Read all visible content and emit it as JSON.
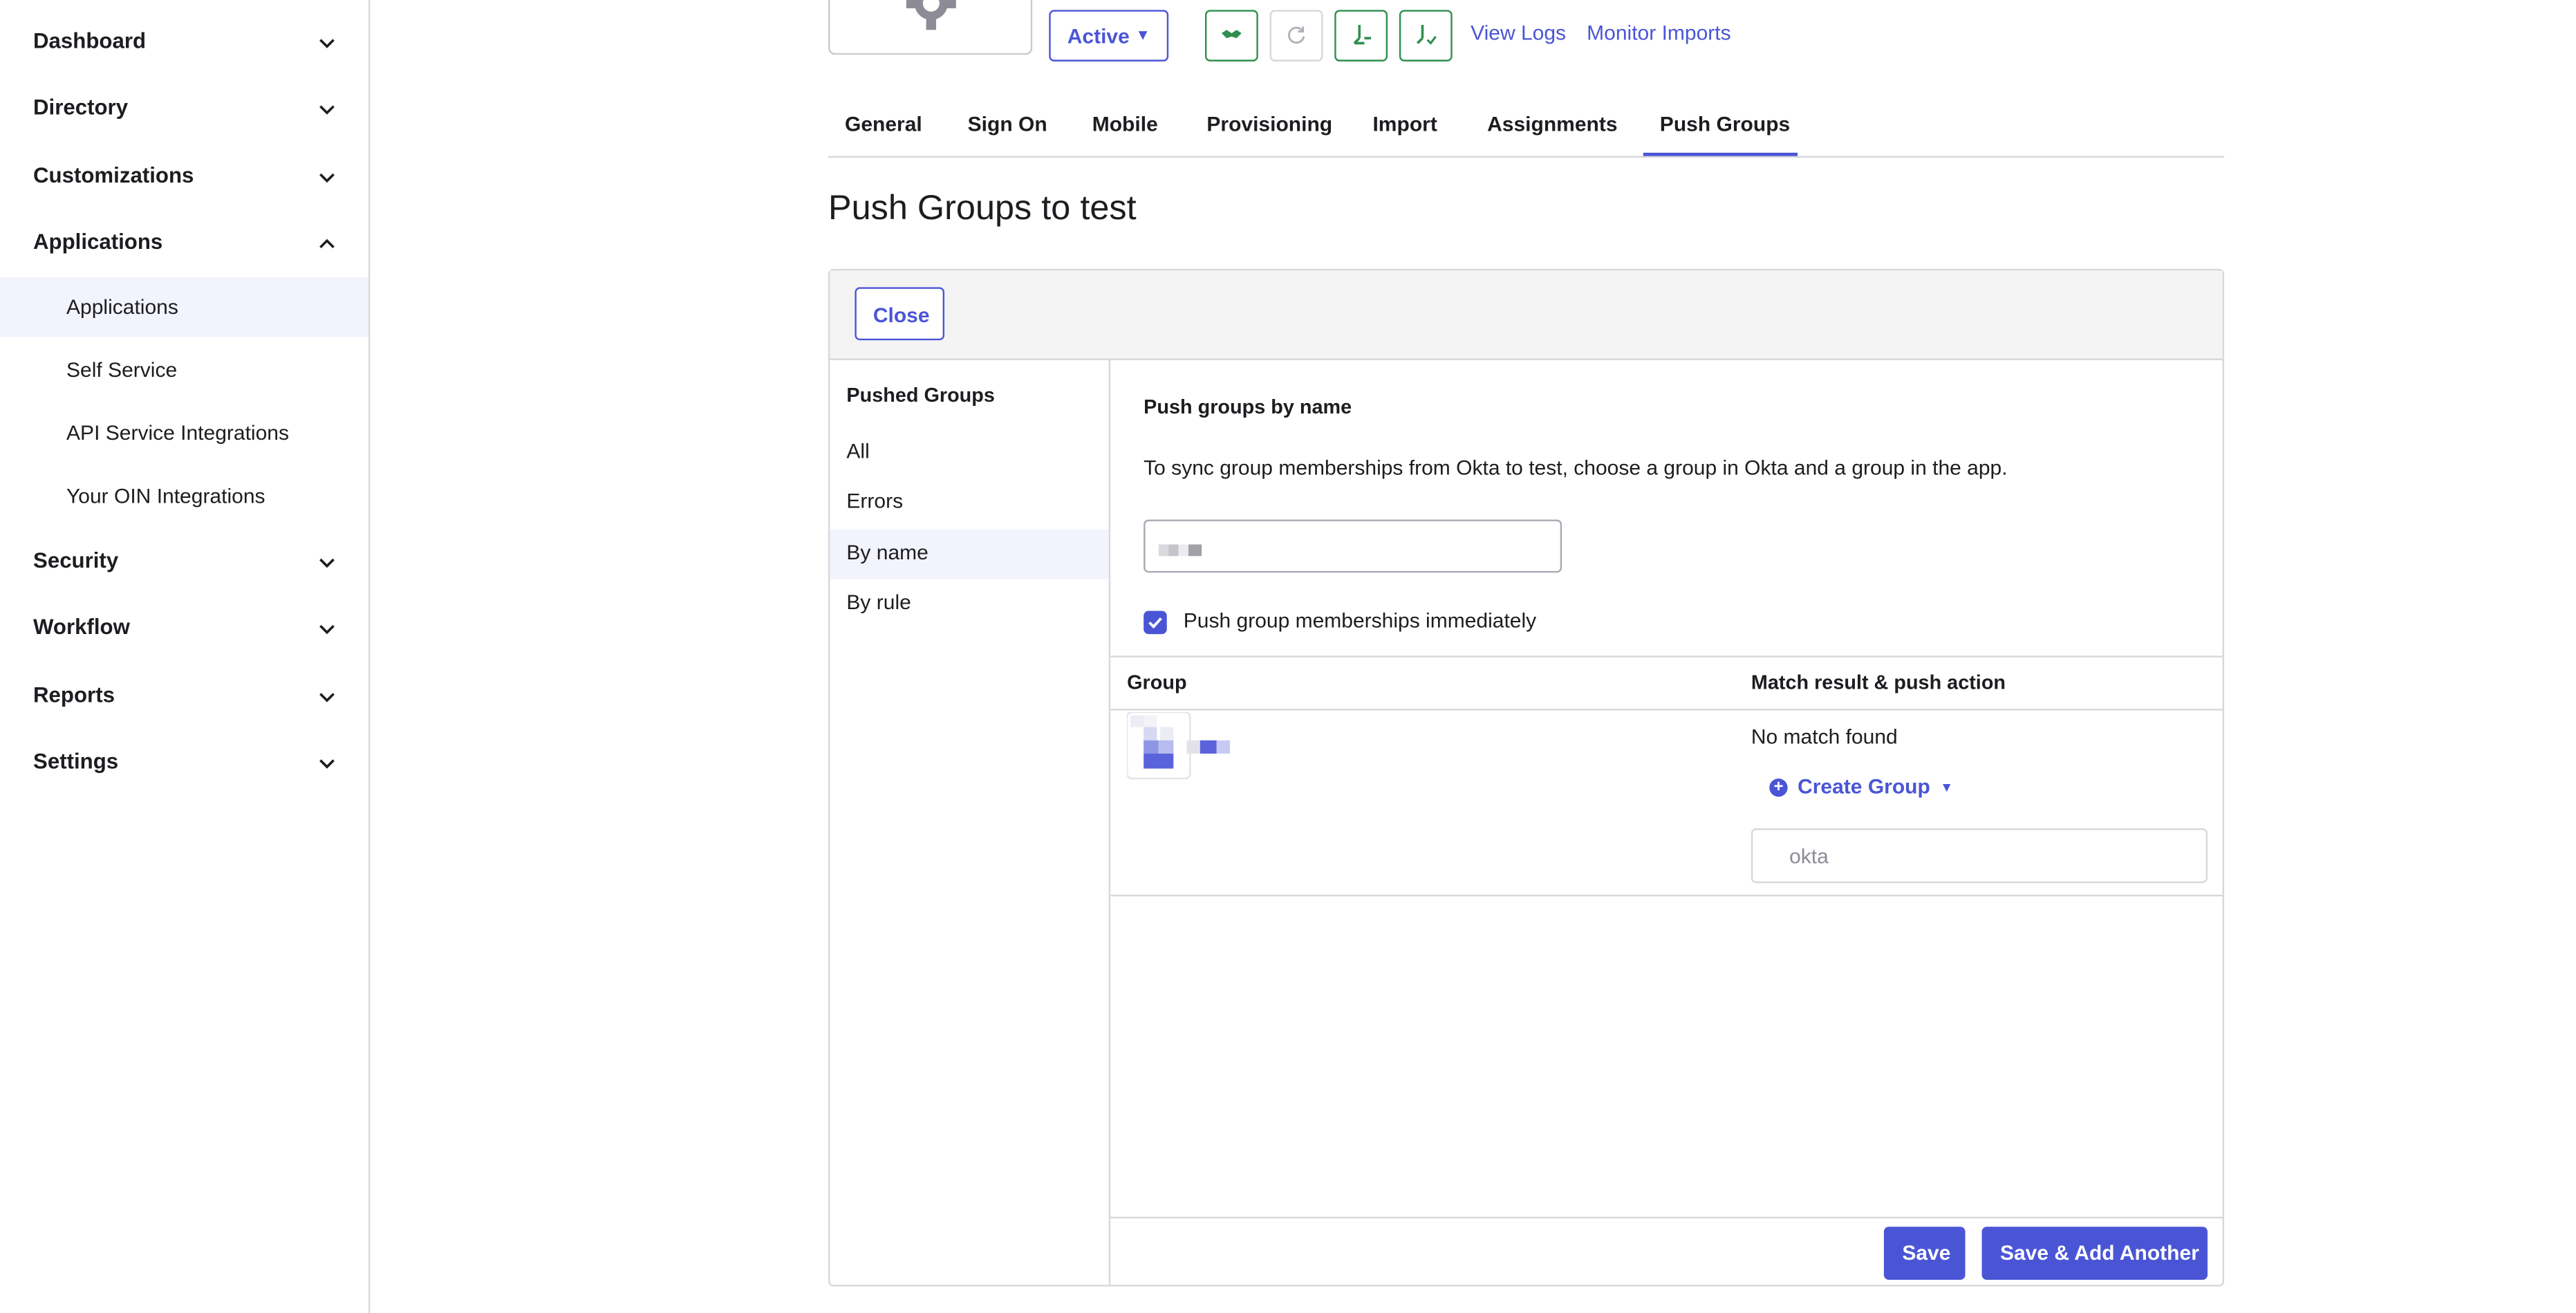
{
  "sidebar": {
    "sections": [
      {
        "label": "Dashboard",
        "expanded": false
      },
      {
        "label": "Directory",
        "expanded": false
      },
      {
        "label": "Customizations",
        "expanded": false
      },
      {
        "label": "Applications",
        "expanded": true
      },
      {
        "label": "Security",
        "expanded": false
      },
      {
        "label": "Workflow",
        "expanded": false
      },
      {
        "label": "Reports",
        "expanded": false
      },
      {
        "label": "Settings",
        "expanded": false
      }
    ],
    "applications_items": [
      {
        "label": "Applications",
        "active": true
      },
      {
        "label": "Self Service"
      },
      {
        "label": "API Service Integrations"
      },
      {
        "label": "Your OIN Integrations"
      }
    ]
  },
  "header": {
    "status_label": "Active",
    "action_icons": [
      "handshake-icon",
      "refresh-icon",
      "user-push-icon",
      "user-check-icon"
    ],
    "view_logs": "View Logs",
    "monitor_imports": "Monitor Imports"
  },
  "tabs": [
    {
      "label": "General"
    },
    {
      "label": "Sign On"
    },
    {
      "label": "Mobile"
    },
    {
      "label": "Provisioning"
    },
    {
      "label": "Import"
    },
    {
      "label": "Assignments"
    },
    {
      "label": "Push Groups",
      "active": true
    }
  ],
  "page_title": "Push Groups to test",
  "panel": {
    "close_label": "Close",
    "pushed_groups_heading": "Pushed Groups",
    "filters": [
      {
        "label": "All"
      },
      {
        "label": "Errors"
      },
      {
        "label": "By name",
        "active": true
      },
      {
        "label": "By rule"
      }
    ],
    "right": {
      "title": "Push groups by name",
      "description": "To sync group memberships from Okta to test, choose a group in Okta and a group in the app.",
      "push_immediately_label": "Push group memberships immediately",
      "push_immediately_checked": true,
      "columns": {
        "group": "Group",
        "match": "Match result & push action"
      },
      "row": {
        "match_result": "No match found",
        "create_group_label": "Create Group",
        "group_input_placeholder": "okta"
      },
      "save_label": "Save",
      "save_add_label": "Save & Add Another"
    }
  },
  "colors": {
    "accent": "#4a55d6",
    "success": "#2f8f4e",
    "border": "#d7d7dc"
  }
}
